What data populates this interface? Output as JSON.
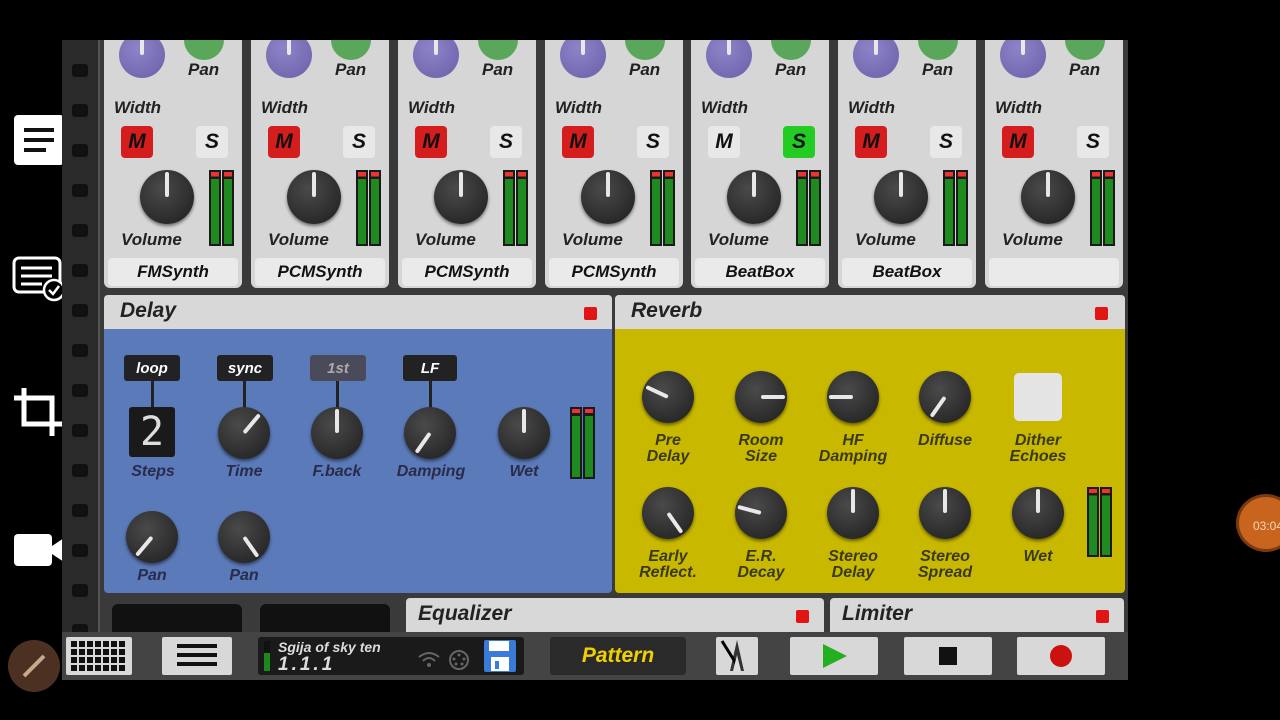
{
  "overlay": {
    "menu_icon": "hamburger-icon",
    "tasks_icon": "task-list-check-icon",
    "crop_icon": "crop-icon",
    "camera_icon": "video-camera-icon",
    "timer": "03:04"
  },
  "mixer": {
    "pan_label": "Pan",
    "width_label": "Width",
    "volume_label": "Volume",
    "mute_label": "M",
    "solo_label": "S",
    "channels": [
      {
        "name": "FMSynth",
        "mute": true,
        "solo": false
      },
      {
        "name": "PCMSynth",
        "mute": true,
        "solo": false
      },
      {
        "name": "PCMSynth",
        "mute": true,
        "solo": false
      },
      {
        "name": "PCMSynth",
        "mute": true,
        "solo": false
      },
      {
        "name": "BeatBox",
        "mute": false,
        "solo": true
      },
      {
        "name": "BeatBox",
        "mute": true,
        "solo": false
      },
      {
        "name": "",
        "mute": true,
        "solo": false
      }
    ]
  },
  "delay": {
    "title": "Delay",
    "tags": {
      "loop": "loop",
      "sync": "sync",
      "first": "1st",
      "lf": "LF"
    },
    "steps_value": "2",
    "labels": {
      "steps": "Steps",
      "time": "Time",
      "feedback": "F.back",
      "damping": "Damping",
      "wet": "Wet",
      "pan1": "Pan",
      "pan2": "Pan"
    }
  },
  "reverb": {
    "title": "Reverb",
    "labels": {
      "pre_delay": [
        "Pre",
        "Delay"
      ],
      "room_size": [
        "Room",
        "Size"
      ],
      "hf_damping": [
        "HF",
        "Damping"
      ],
      "diffuse": "Diffuse",
      "dither": [
        "Dither",
        "Echoes"
      ],
      "early": [
        "Early",
        "Reflect."
      ],
      "er_decay": [
        "E.R.",
        "Decay"
      ],
      "stereo_delay": [
        "Stereo",
        "Delay"
      ],
      "stereo_spread": [
        "Stereo",
        "Spread"
      ],
      "wet": "Wet"
    }
  },
  "equalizer": {
    "title": "Equalizer"
  },
  "limiter": {
    "title": "Limiter"
  },
  "transport": {
    "song_name": "Sgija of sky ten",
    "position": "1.1.1",
    "pattern_label": "Pattern",
    "colors": {
      "play": "#22b022",
      "record": "#cc1111",
      "pattern_text": "#f0d000"
    }
  },
  "colors": {
    "mute_on": "#d61d1d",
    "solo_on": "#22cc22",
    "delay_bg": "#5b7ab9",
    "reverb_bg": "#c8b800"
  }
}
